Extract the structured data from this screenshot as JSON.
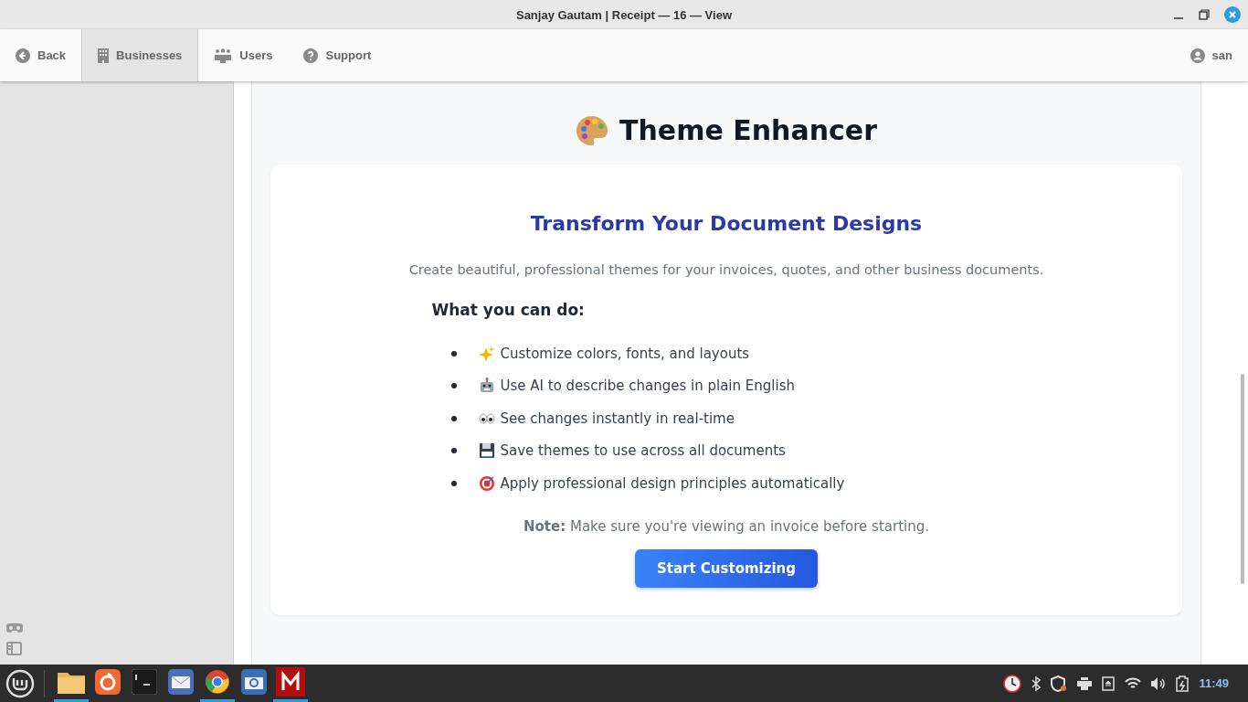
{
  "window": {
    "title": "Sanjay Gautam | Receipt — 16 — View"
  },
  "nav": {
    "items": [
      {
        "kind": "back",
        "label": "Back",
        "selected": false
      },
      {
        "kind": "building",
        "label": "Businesses",
        "selected": true
      },
      {
        "kind": "users",
        "label": "Users",
        "selected": false
      },
      {
        "kind": "help",
        "label": "Support",
        "selected": false
      }
    ],
    "user": "san"
  },
  "page": {
    "title": "Theme Enhancer",
    "card": {
      "heading": "Transform Your Document Designs",
      "intro": "Create beautiful, professional themes for your invoices, quotes, and other business documents.",
      "list_title": "What you can do:",
      "features": [
        {
          "kind": "sparkles",
          "text": "Customize colors, fonts, and layouts"
        },
        {
          "kind": "robot",
          "text": "Use AI to describe changes in plain English"
        },
        {
          "kind": "eyes",
          "text": "See changes instantly in real-time"
        },
        {
          "kind": "disk",
          "text": "Save themes to use across all documents"
        },
        {
          "kind": "target",
          "text": "Apply professional design principles automatically"
        }
      ],
      "note": "**Note:** Make sure you're viewing an invoice before starting.",
      "button": "Start Customizing"
    }
  },
  "taskbar": {
    "apps": [
      {
        "kind": "folder",
        "running": true
      },
      {
        "kind": "firefox",
        "running": false
      },
      {
        "kind": "terminal",
        "running": false
      },
      {
        "kind": "mail",
        "running": false
      },
      {
        "kind": "chrome",
        "running": true
      },
      {
        "kind": "camera",
        "running": false
      },
      {
        "kind": "m",
        "running": true
      }
    ],
    "clock": "11:49"
  }
}
